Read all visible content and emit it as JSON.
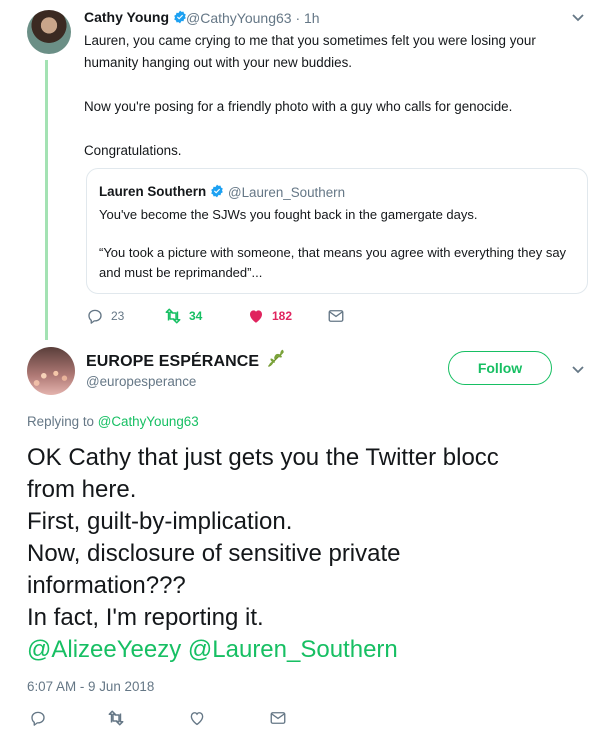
{
  "tweet1": {
    "author_name": "Cathy Young",
    "handle_time": "@CathyYoung63 · 1h",
    "paragraphs": [
      "Lauren, you came crying to me that you sometimes felt you were losing your humanity hanging out with your new buddies.",
      "Now you're posing for a friendly photo with a guy who calls for genocide.",
      "Congratulations."
    ],
    "quote": {
      "author_name": "Lauren Southern",
      "handle": "@Lauren_Southern",
      "line1": "You've become the SJWs you fought back in the gamergate days.",
      "line2": "“You took a picture with someone, that means you agree with everything they say and must be reprimanded”..."
    },
    "replies": "23",
    "retweets": "34",
    "likes": "182"
  },
  "tweet2": {
    "author_name": "EUROPE ESPÉRANCE",
    "handle": "@europesperance",
    "follow_label": "Follow",
    "replying_prefix": "Replying to",
    "replying_to": "@CathyYoung63",
    "lines": [
      "OK Cathy that just gets you the Twitter blocc",
      "from here.",
      "First, guilt-by-implication.",
      "Now, disclosure of sensitive private",
      "information???",
      "In fact, I'm reporting it."
    ],
    "mention1": "@AlizeeYeezy",
    "mention2": "@Lauren_Southern",
    "date": "6:07 AM - 9 Jun 2018"
  },
  "colors": {
    "accent_green": "#17bf63",
    "thread_line": "#a3e2b3",
    "like_red": "#e0245e",
    "muted": "#657786"
  }
}
